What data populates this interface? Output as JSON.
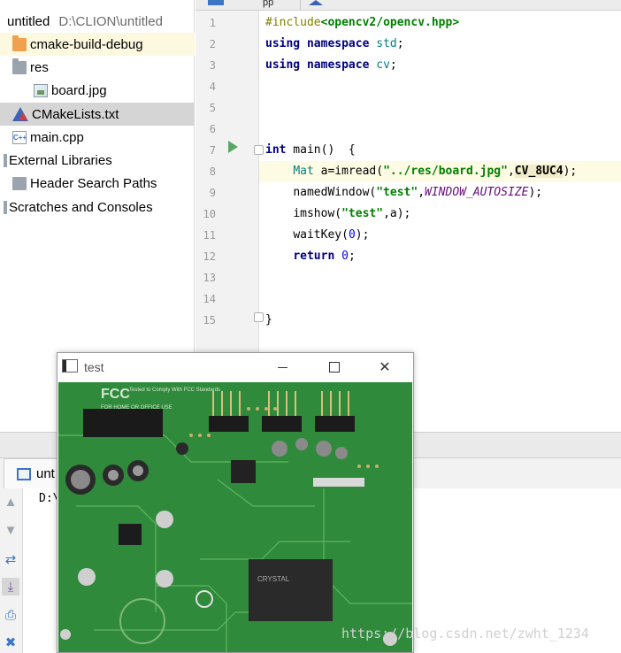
{
  "project": {
    "root": {
      "name": "untitled",
      "path": "D:\\CLION\\untitled"
    },
    "items": [
      {
        "label": "cmake-build-debug",
        "icon": "folder-orange-icon"
      },
      {
        "label": "res",
        "icon": "folder-icon"
      },
      {
        "label": "board.jpg",
        "icon": "image-file-icon"
      },
      {
        "label": "CMakeLists.txt",
        "icon": "cmake-icon"
      },
      {
        "label": "main.cpp",
        "icon": "cpp-file-icon"
      },
      {
        "label": "External Libraries",
        "icon": "libraries-icon"
      },
      {
        "label": "Header Search Paths",
        "icon": "header-folder-icon"
      },
      {
        "label": "Scratches and Consoles",
        "icon": "scratches-icon"
      }
    ]
  },
  "editor": {
    "tabs": [
      "pp"
    ],
    "line_numbers": [
      "1",
      "2",
      "3",
      "4",
      "5",
      "6",
      "7",
      "8",
      "9",
      "10",
      "11",
      "12",
      "13",
      "14",
      "15"
    ],
    "code": {
      "l1_directive": "#include",
      "l1_header": "<opencv2/opencv.hpp>",
      "l2_using": "using",
      "l2_namespace": "namespace",
      "l2_name": "std",
      "l3_using": "using",
      "l3_namespace": "namespace",
      "l3_name": "cv",
      "l7_type": "int",
      "l7_rest": " main()  {",
      "l8_type": "Mat",
      "l8_call": " a=imread(",
      "l8_str": "\"../res/board.jpg\"",
      "l8_macro": "CV_8UC4",
      "l8_end": ");",
      "l9_call": "namedWindow(",
      "l9_str": "\"test\"",
      "l9_macro": "WINDOW_AUTOSIZE",
      "l9_end": ");",
      "l10_call": "imshow(",
      "l10_str": "\"test\"",
      "l10_end": ",a);",
      "l11_call": "waitKey(",
      "l11_num": "0",
      "l11_end": ");",
      "l12_kw": "return",
      "l12_num": "0",
      "l12_end": ";",
      "l15_brace": "}"
    }
  },
  "run": {
    "tab_label": "unt",
    "console_text": "D:\\"
  },
  "cv_window": {
    "title": "test",
    "close_glyph": "✕",
    "image_text": {
      "fcc": "FCC",
      "fcc_small": "Tested to Comply With FCC Standards",
      "home": "FOR HOME OR OFFICE USE",
      "chip": "CRYSTAL"
    }
  },
  "watermark": "https://blog.csdn.net/zwht_1234",
  "colors": {
    "pcb_green": "#2f8a3b",
    "keyword": "#000080",
    "string": "#008000",
    "macro": "#660e7a",
    "run_arrow": "#59a869"
  }
}
